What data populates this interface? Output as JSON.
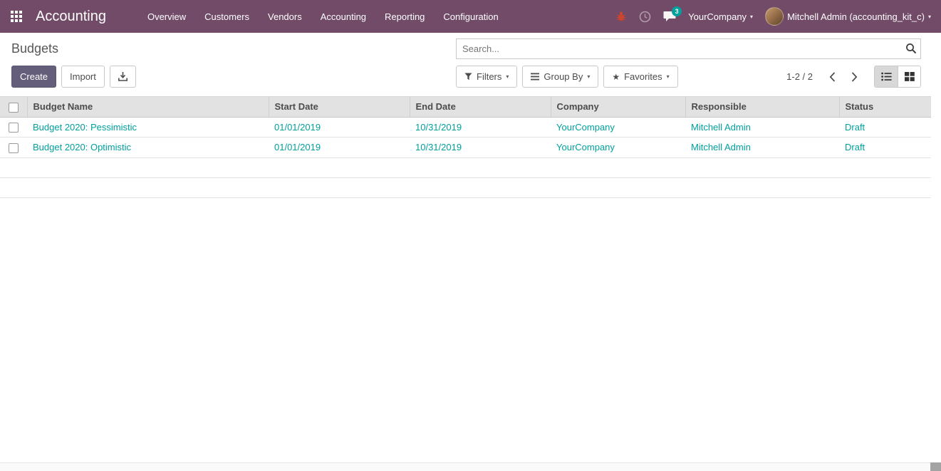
{
  "topbar": {
    "app_name": "Accounting",
    "menus": [
      "Overview",
      "Customers",
      "Vendors",
      "Accounting",
      "Reporting",
      "Configuration"
    ],
    "systray": {
      "message_count": "3",
      "company": "YourCompany",
      "user": "Mitchell Admin (accounting_kit_c)"
    }
  },
  "control_panel": {
    "title": "Budgets",
    "search": {
      "placeholder": "Search..."
    },
    "buttons": {
      "create": "Create",
      "import": "Import"
    },
    "filters": {
      "filters": "Filters",
      "group_by": "Group By",
      "favorites": "Favorites"
    },
    "pager": {
      "range": "1-2 / 2"
    }
  },
  "table": {
    "headers": [
      "Budget Name",
      "Start Date",
      "End Date",
      "Company",
      "Responsible",
      "Status"
    ],
    "rows": [
      {
        "name": "Budget 2020: Pessimistic",
        "start": "01/01/2019",
        "end": "10/31/2019",
        "company": "YourCompany",
        "responsible": "Mitchell Admin",
        "status": "Draft"
      },
      {
        "name": "Budget 2020: Optimistic",
        "start": "01/01/2019",
        "end": "10/31/2019",
        "company": "YourCompany",
        "responsible": "Mitchell Admin",
        "status": "Draft"
      }
    ]
  },
  "colors": {
    "topbar_bg": "#714B67",
    "link_teal": "#00a09d",
    "primary_button": "#655e7a",
    "badge": "#00a09d"
  }
}
